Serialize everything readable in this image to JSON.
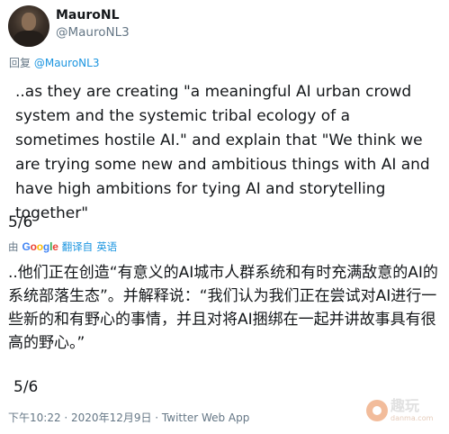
{
  "author": {
    "display_name": "MauroNL",
    "handle": "@MauroNL3"
  },
  "reply": {
    "prefix": "回复",
    "mention": "@MauroNL3"
  },
  "tweet": {
    "text_en": "..as they are creating \"a meaningful AI urban crowd system and the systemic tribal ecology of a sometimes hostile AI.\" and explain that \"We think we are trying some new and ambitious things with AI and have high ambitions for tying AI and storytelling together\"",
    "page_en": "5/6"
  },
  "translation": {
    "by": "由",
    "google_letters": [
      "G",
      "o",
      "o",
      "g",
      "l",
      "e"
    ],
    "label_prefix": "翻",
    "label_error": "译自",
    "language": "英语",
    "text_zh": "..他们正在创造“有意义的AI城市人群系统和有时充满敌意的AI的系统部落生态”。并解释说：“我们认为我们正在尝试对AI进行一些新的和有野心的事情，并且对将AI捆绑在一起并讲故事具有很高的野心。”",
    "page_zh": "5/6"
  },
  "meta": {
    "text": "下午10:22 · 2020年12月9日 · Twitter Web App"
  },
  "watermark": {
    "main": "趣玩",
    "sub": "danma.com"
  },
  "icons": {
    "avatar": "user-avatar",
    "watermark_logo": "watermark-logo-icon"
  },
  "colors": {
    "link": "#1b95e0",
    "secondary_text": "#657786",
    "primary_text": "#14171a"
  }
}
